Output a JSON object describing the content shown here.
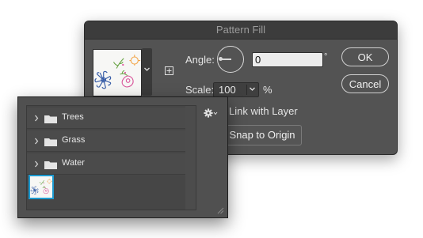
{
  "dialog": {
    "title": "Pattern Fill",
    "angle_label": "Angle:",
    "angle_value": "0",
    "angle_unit": "°",
    "scale_label": "Scale:",
    "scale_value": "100",
    "scale_unit": "%",
    "link_label": "Link with Layer",
    "snap_label": "Snap to Origin",
    "ok_label": "OK",
    "cancel_label": "Cancel"
  },
  "preset_panel": {
    "groups": [
      {
        "label": "Trees",
        "icon": "folder-icon"
      },
      {
        "label": "Grass",
        "icon": "folder-icon"
      },
      {
        "label": "Water",
        "icon": "folder-icon"
      }
    ],
    "selected_pattern": "floral-pattern-thumbnail"
  },
  "colors": {
    "dialog_bg": "#535353",
    "titlebar_bg": "#3c3c3c",
    "selection_accent": "#1d9bd1",
    "pattern_blue": "#3a5fa8",
    "pattern_pink": "#d9579b",
    "pattern_orange": "#f3a64a",
    "pattern_green": "#6da64a"
  }
}
